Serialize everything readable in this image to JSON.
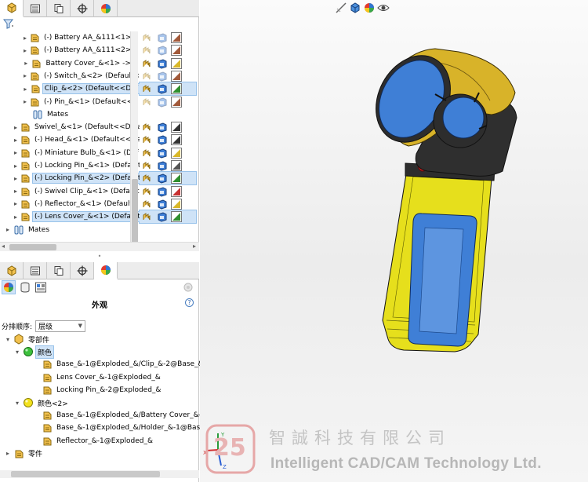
{
  "feature_tree": {
    "tabs": [
      "feature-manager",
      "property-manager",
      "configuration-manager",
      "dimxpert-manager",
      "display-manager"
    ],
    "filter_icon": "funnel-icon",
    "items": [
      {
        "label": "(-) Battery AA_&111<1> (I",
        "indent": 2,
        "icon": "part-icon",
        "arrow": true,
        "selected": false,
        "state_color": "#a25a3b"
      },
      {
        "label": "(-) Battery AA_&111<2> (I",
        "indent": 2,
        "icon": "part-icon",
        "arrow": true,
        "selected": false,
        "state_color": "#a25a3b"
      },
      {
        "label": "Battery Cover_&<1> -> (I",
        "indent": 2,
        "icon": "part-icon",
        "arrow": true,
        "selected": false,
        "state_color": "#d9b82a"
      },
      {
        "label": "(-) Switch_&<2> (Default<",
        "indent": 2,
        "icon": "part-icon",
        "arrow": true,
        "selected": false,
        "state_color": "#a25a3b"
      },
      {
        "label": "Clip_&<2> (Default<<Def",
        "indent": 2,
        "icon": "part-icon",
        "arrow": true,
        "selected": true,
        "state_color": "#2f8f2f"
      },
      {
        "label": "(-) Pin_&<1> (Default<<D",
        "indent": 2,
        "icon": "part-icon",
        "arrow": true,
        "selected": false,
        "state_color": "#a25a3b"
      },
      {
        "label": "Mates",
        "indent": 2,
        "icon": "mates-icon",
        "arrow": false,
        "selected": false,
        "state_color": ""
      },
      {
        "label": "Swivel_&<1> (Default<<Defau",
        "indent": 1,
        "icon": "part-icon",
        "arrow": true,
        "selected": false,
        "state_color": "#333333"
      },
      {
        "label": "(-) Head_&<1> (Default<<De",
        "indent": 1,
        "icon": "part-icon",
        "arrow": true,
        "selected": false,
        "state_color": "#333333"
      },
      {
        "label": "(-) Miniature Bulb_&<1> (Def",
        "indent": 1,
        "icon": "part-icon",
        "arrow": true,
        "selected": false,
        "state_color": "#d9b82a"
      },
      {
        "label": "(-) Locking Pin_&<1> (Default",
        "indent": 1,
        "icon": "part-icon",
        "arrow": true,
        "selected": false,
        "state_color": "#555555"
      },
      {
        "label": "(-) Locking Pin_&<2> (Default",
        "indent": 1,
        "icon": "part-icon",
        "arrow": true,
        "selected": true,
        "state_color": "#2f8f2f"
      },
      {
        "label": "(-) Swivel Clip_&<1> (Default",
        "indent": 1,
        "icon": "part-icon",
        "arrow": true,
        "selected": false,
        "state_color": "#c83232"
      },
      {
        "label": "(-) Reflector_&<1> (Default<",
        "indent": 1,
        "icon": "part-icon",
        "arrow": true,
        "selected": false,
        "state_color": "#d9b82a"
      },
      {
        "label": "(-) Lens Cover_&<1> (Default",
        "indent": 1,
        "icon": "part-icon",
        "arrow": true,
        "selected": true,
        "state_color": "#2f8f2f"
      },
      {
        "label": "Mates",
        "indent": 0,
        "icon": "mates-icon",
        "arrow": true,
        "selected": false,
        "state_color": ""
      }
    ]
  },
  "appearance_panel": {
    "title": "外观",
    "help": "?",
    "sort_label": "分排顺序:",
    "sort_value": "层级",
    "items": [
      {
        "label": "零部件",
        "indent": 0,
        "icon": "assembly-icon",
        "arrow": "down",
        "selected": false
      },
      {
        "label": "颜色",
        "indent": 1,
        "icon": "green-sphere-icon",
        "arrow": "down",
        "selected": true
      },
      {
        "label": "Base_&-1@Exploded_&/Clip_&-2@Base_&",
        "indent": 3,
        "icon": "part-icon",
        "arrow": "",
        "selected": false
      },
      {
        "label": "Lens Cover_&-1@Exploded_&",
        "indent": 3,
        "icon": "part-icon",
        "arrow": "",
        "selected": false
      },
      {
        "label": "Locking Pin_&-2@Exploded_&",
        "indent": 3,
        "icon": "part-icon",
        "arrow": "",
        "selected": false
      },
      {
        "label": "颜色<2>",
        "indent": 1,
        "icon": "yellow-sphere-icon",
        "arrow": "down",
        "selected": false
      },
      {
        "label": "Base_&-1@Exploded_&/Battery Cover_&-1",
        "indent": 3,
        "icon": "part-icon",
        "arrow": "",
        "selected": false
      },
      {
        "label": "Base_&-1@Exploded_&/Holder_&-1@Base",
        "indent": 3,
        "icon": "part-icon",
        "arrow": "",
        "selected": false
      },
      {
        "label": "Reflector_&-1@Exploded_&",
        "indent": 3,
        "icon": "part-icon",
        "arrow": "",
        "selected": false
      },
      {
        "label": "零件",
        "indent": 0,
        "icon": "part-icon",
        "arrow": "right",
        "selected": false
      }
    ]
  },
  "viewport": {
    "model": "flashlight-assembly",
    "colors": {
      "body": "#e6df1c",
      "blue": "#3f7fd6",
      "dark": "#2d2d2d",
      "head": "#d8b329",
      "red": "#c8201e"
    }
  },
  "watermark": {
    "chinese": "智誠科技有限公司",
    "english": "Intelligent CAD/CAM Technology Ltd."
  }
}
